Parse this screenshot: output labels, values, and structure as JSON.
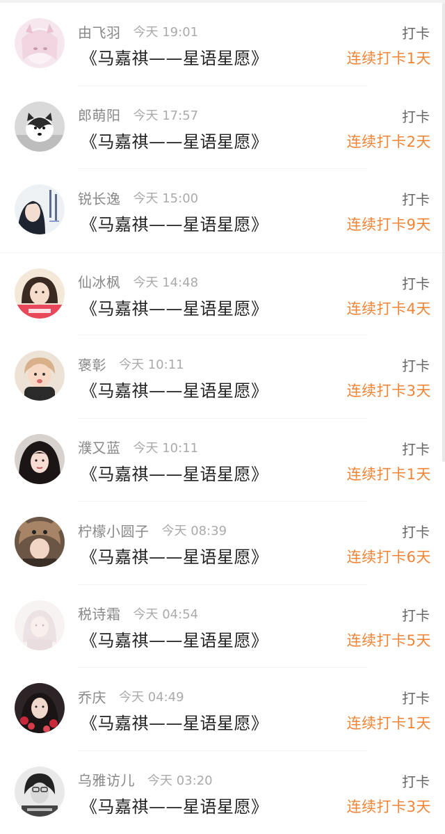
{
  "checkins": [
    {
      "name": "由飞羽",
      "time": "今天 19:01",
      "title": "《马嘉祺——星语星愿》",
      "action": "打卡",
      "streak": "连续打卡1天",
      "avatar": "avatar-anime-girl-pink"
    },
    {
      "name": "郎萌阳",
      "time": "今天 17:57",
      "title": "《马嘉祺——星语星愿》",
      "action": "打卡",
      "streak": "连续打卡2天",
      "avatar": "avatar-husky-dog"
    },
    {
      "name": "锐长逸",
      "time": "今天 15:00",
      "title": "《马嘉祺——星语星愿》",
      "action": "打卡",
      "streak": "连续打卡9天",
      "avatar": "avatar-girl-with-text"
    },
    {
      "name": "仙冰枫",
      "time": "今天 14:48",
      "title": "《马嘉祺——星语星愿》",
      "action": "打卡",
      "streak": "连续打卡4天",
      "avatar": "avatar-girl-red-banner"
    },
    {
      "name": "褒彰",
      "time": "今天 10:11",
      "title": "《马嘉祺——星语星愿》",
      "action": "打卡",
      "streak": "连续打卡3天",
      "avatar": "avatar-toddler"
    },
    {
      "name": "濮又蓝",
      "time": "今天 10:11",
      "title": "《马嘉祺——星语星愿》",
      "action": "打卡",
      "streak": "连续打卡1天",
      "avatar": "avatar-girl-dark-hair"
    },
    {
      "name": "柠檬小圆子",
      "time": "今天 08:39",
      "title": "《马嘉祺——星语星愿》",
      "action": "打卡",
      "streak": "连续打卡6天",
      "avatar": "avatar-girl-bear-hat"
    },
    {
      "name": "税诗霜",
      "time": "今天 04:54",
      "title": "《马嘉祺——星语星愿》",
      "action": "打卡",
      "streak": "连续打卡5天",
      "avatar": "avatar-faded-girl"
    },
    {
      "name": "乔庆",
      "time": "今天 04:49",
      "title": "《马嘉祺——星语星愿》",
      "action": "打卡",
      "streak": "连续打卡1天",
      "avatar": "avatar-girl-red-flowers"
    },
    {
      "name": "乌雅访儿",
      "time": "今天 03:20",
      "title": "《马嘉祺——星语星愿》",
      "action": "打卡",
      "streak": "连续打卡3天",
      "avatar": "avatar-monochrome-photo"
    }
  ],
  "colors": {
    "streak": "#f08437",
    "name": "#888888",
    "time": "#aaaaaa",
    "title": "#222222",
    "action": "#666666"
  }
}
